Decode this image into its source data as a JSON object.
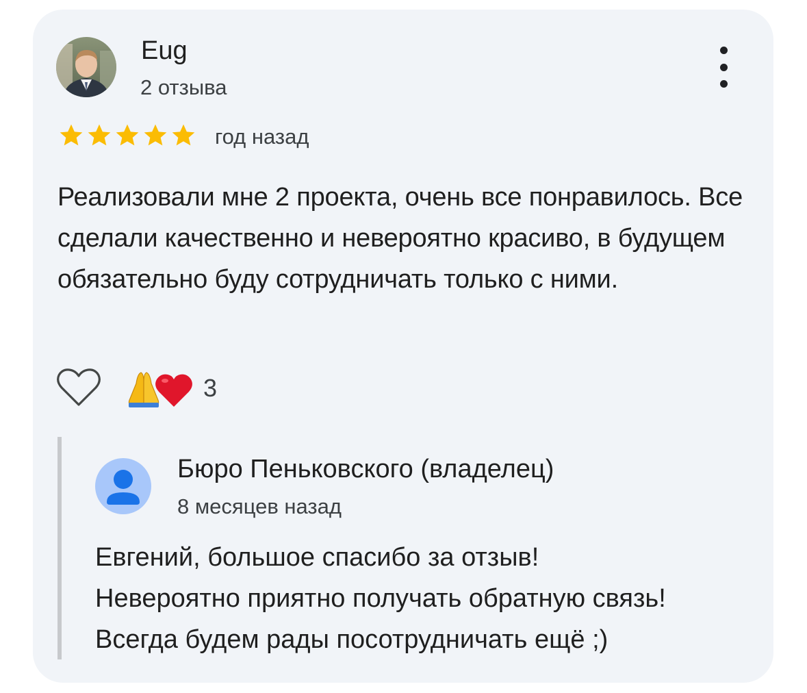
{
  "review": {
    "author_name": "Eug",
    "author_reviews": "2 отзыва",
    "rating": 5,
    "rating_max": 5,
    "date": "год назад",
    "text": "Реализовали мне 2 проекта, очень все понравилось. Все сделали качественно и невероятно красиво, в будущем обязательно буду сотрудничать только с ними.",
    "reaction_count": "3",
    "reaction_emojis": [
      "🙏",
      "❤️"
    ]
  },
  "reply": {
    "owner_name": "Бюро Пеньковского (владелец)",
    "date": "8 месяцев назад",
    "lines": [
      "Евгений, большое спасибо за отзыв!",
      "Невероятно приятно получать обратную связь!",
      "Всегда будем рады посотрудничать ещё ;)"
    ]
  },
  "colors": {
    "card_background": "#f1f4f8",
    "star": "#fbbc04",
    "owner_avatar_bg": "#a8c7fa",
    "owner_avatar_icon": "#1a73e8"
  },
  "icons": {
    "menu": "more-vertical-icon",
    "like": "heart-outline-icon",
    "star": "star-icon",
    "owner_avatar": "person-icon"
  }
}
